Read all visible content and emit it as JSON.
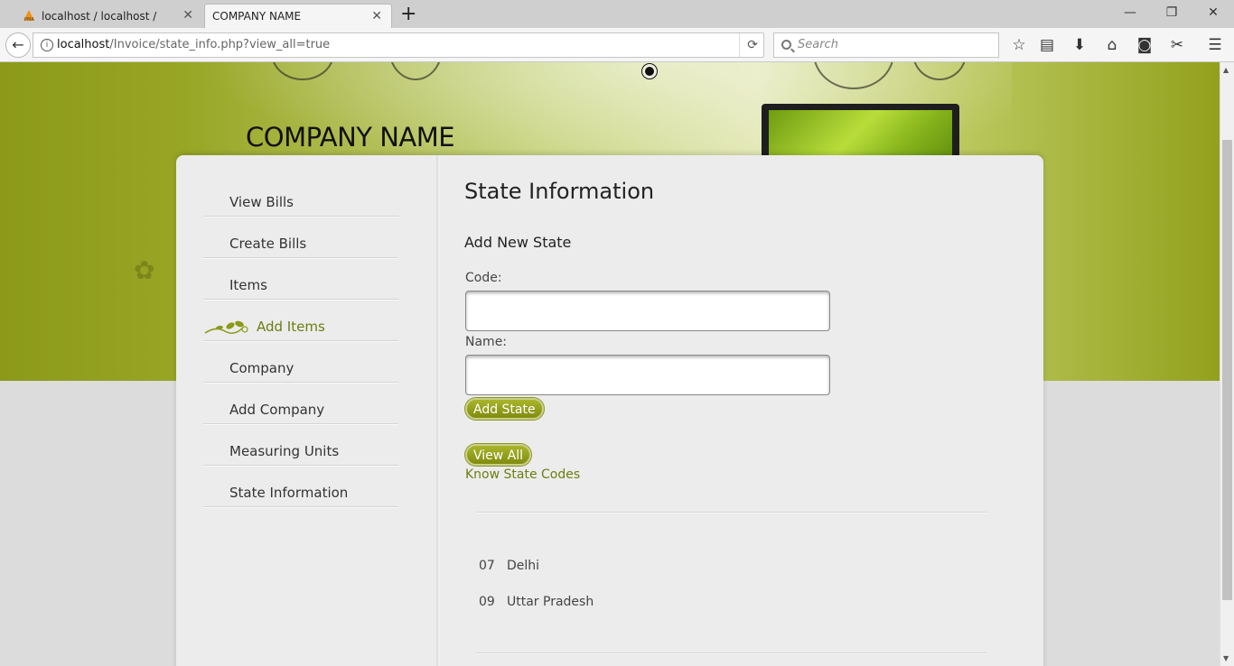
{
  "browser": {
    "tabs": [
      {
        "label": "localhost / localhost / invoic",
        "active": false
      },
      {
        "label": "COMPANY NAME",
        "active": true
      }
    ],
    "new_tab": "+",
    "url_host": "localhost",
    "url_path": "/Invoice/state_info.php?view_all=true",
    "search_placeholder": "Search"
  },
  "site": {
    "company_name": "COMPANY NAME"
  },
  "sidebar": {
    "items": [
      {
        "label": "View Bills"
      },
      {
        "label": "Create Bills"
      },
      {
        "label": "Items"
      },
      {
        "label": "Add Items"
      },
      {
        "label": "Company"
      },
      {
        "label": "Add Company"
      },
      {
        "label": "Measuring Units"
      },
      {
        "label": "State Information"
      }
    ]
  },
  "main": {
    "title": "State Information",
    "section_title": "Add New State",
    "code_label": "Code:",
    "code_value": "",
    "name_label": "Name:",
    "name_value": "",
    "add_button": "Add State",
    "view_all_button": "View All",
    "know_codes_link": "Know State Codes",
    "states": [
      {
        "code": "07",
        "name": "Delhi"
      },
      {
        "code": "09",
        "name": "Uttar Pradesh"
      }
    ]
  },
  "colors": {
    "accent": "#8b9a18",
    "link": "#6d7d10",
    "background": "#dcdcdc"
  }
}
